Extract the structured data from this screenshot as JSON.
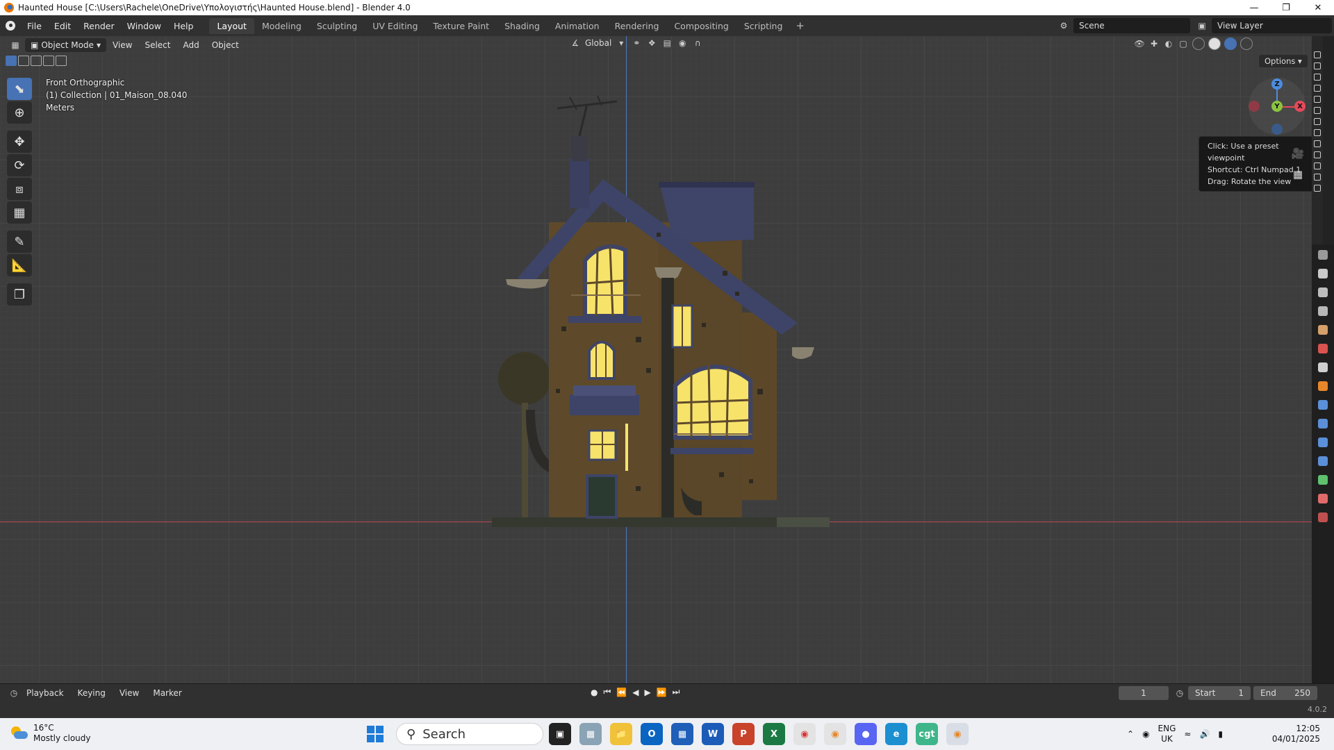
{
  "window": {
    "title": "Haunted House [C:\\Users\\Rachele\\OneDrive\\Υπολογιστής\\Haunted House.blend] - Blender 4.0"
  },
  "menubar": {
    "menus": [
      "File",
      "Edit",
      "Render",
      "Window",
      "Help"
    ],
    "workspaces": [
      "Layout",
      "Modeling",
      "Sculpting",
      "UV Editing",
      "Texture Paint",
      "Shading",
      "Animation",
      "Rendering",
      "Compositing",
      "Scripting"
    ],
    "active_workspace": "Layout",
    "scene": "Scene",
    "view_layer": "View Layer"
  },
  "viewport": {
    "mode": "Object Mode",
    "menus": [
      "View",
      "Select",
      "Add",
      "Object"
    ],
    "orientation": "Global",
    "options": "Options",
    "info": {
      "view": "Front Orthographic",
      "collection": "(1) Collection | 01_Maison_08.040",
      "units": "Meters"
    },
    "gizmo": {
      "z": "Z",
      "y": "Y",
      "x": "X"
    },
    "tooltip": {
      "line1": "Click: Use a preset viewpoint",
      "line2": "Shortcut: Ctrl Numpad 1",
      "line3": "Drag: Rotate the view"
    },
    "tools": [
      "select-box",
      "cursor",
      "move",
      "rotate",
      "scale",
      "transform",
      "annotate",
      "measure",
      "add-cube"
    ]
  },
  "timeline": {
    "menus": [
      "Playback",
      "Keying",
      "View",
      "Marker"
    ],
    "current_frame": "1",
    "start_label": "Start",
    "start": "1",
    "end_label": "End",
    "end": "250"
  },
  "status": {
    "version": "4.0.2"
  },
  "taskbar": {
    "temperature": "16°C",
    "weather": "Mostly cloudy",
    "search": "Search",
    "language": "ENG",
    "region": "UK",
    "time": "12:05",
    "date": "04/01/2025"
  },
  "colors": {
    "accent": "#4772b3",
    "axis_x": "#c0484f",
    "axis_y": "#4d78c2",
    "window_light": "#f7e36a",
    "roof": "#3e4468",
    "wall": "#5e4a2a"
  }
}
